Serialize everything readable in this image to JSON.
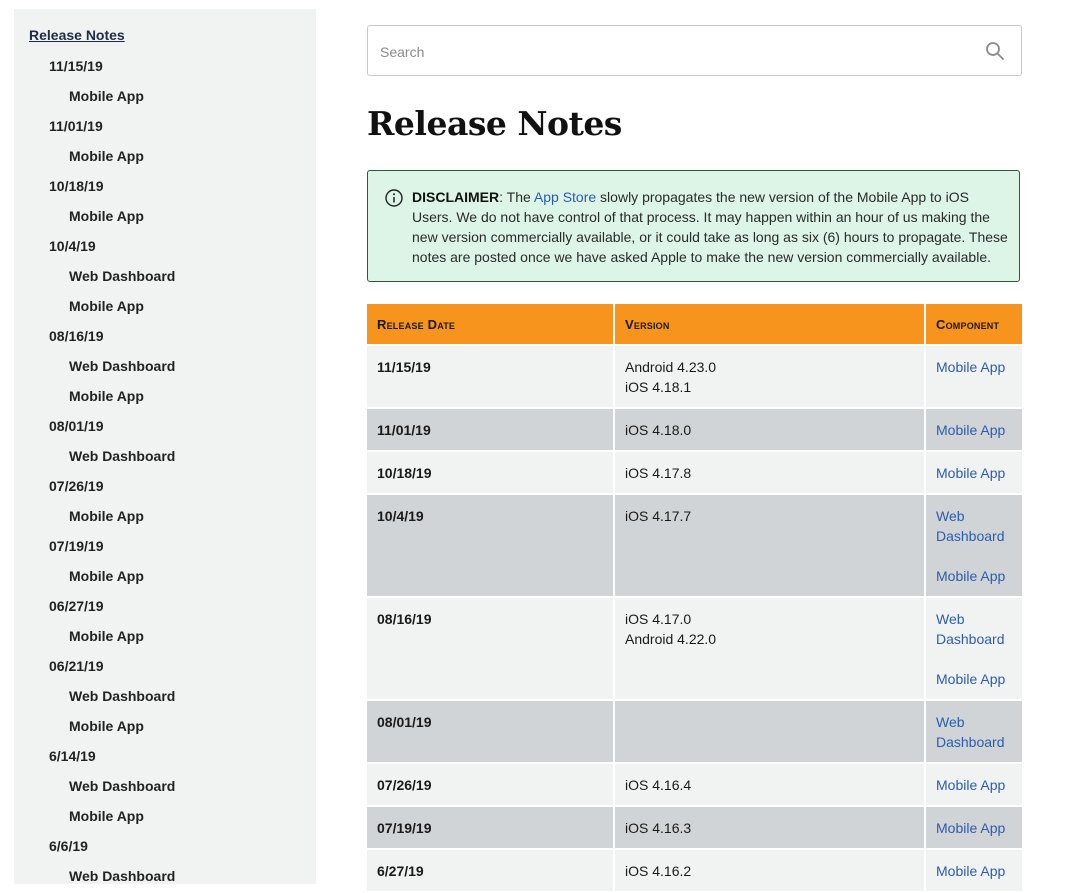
{
  "sidebar": {
    "root": "Release Notes",
    "items": [
      {
        "date": "11/15/19",
        "components": [
          "Mobile App"
        ]
      },
      {
        "date": "11/01/19",
        "components": [
          "Mobile App"
        ]
      },
      {
        "date": "10/18/19",
        "components": [
          "Mobile App"
        ]
      },
      {
        "date": "10/4/19",
        "components": [
          "Web Dashboard",
          "Mobile App"
        ]
      },
      {
        "date": "08/16/19",
        "components": [
          "Web Dashboard",
          "Mobile App"
        ]
      },
      {
        "date": "08/01/19",
        "components": [
          "Web Dashboard"
        ]
      },
      {
        "date": "07/26/19",
        "components": [
          "Mobile App"
        ]
      },
      {
        "date": "07/19/19",
        "components": [
          "Mobile App"
        ]
      },
      {
        "date": "06/27/19",
        "components": [
          "Mobile App"
        ]
      },
      {
        "date": "06/21/19",
        "components": [
          "Web Dashboard",
          "Mobile App"
        ]
      },
      {
        "date": "6/14/19",
        "components": [
          "Web Dashboard",
          "Mobile App"
        ]
      },
      {
        "date": "6/6/19",
        "components": [
          "Web Dashboard"
        ]
      }
    ]
  },
  "search": {
    "placeholder": "Search",
    "icon": "search-icon"
  },
  "page": {
    "title": "Release Notes"
  },
  "disclaimer": {
    "icon": "info-icon",
    "label": "DISCLAIMER",
    "text_before_link": ": The ",
    "link_text": "App Store",
    "text_after_link": " slowly propagates the new version of the Mobile App to iOS Users. We do not have control of that process. It may happen within an hour of us making the new version commercially available, or it could take as long as six (6) hours to propagate. These notes are posted once we have asked Apple to make the new version commercially available."
  },
  "table": {
    "headers": [
      "Release Date",
      "Version",
      "Component"
    ],
    "rows": [
      {
        "date": "11/15/19",
        "versions": [
          "Android 4.23.0",
          "iOS 4.18.1"
        ],
        "components": [
          "Mobile App"
        ]
      },
      {
        "date": "11/01/19",
        "versions": [
          "iOS 4.18.0"
        ],
        "components": [
          "Mobile App"
        ]
      },
      {
        "date": "10/18/19",
        "versions": [
          "iOS 4.17.8"
        ],
        "components": [
          "Mobile App"
        ]
      },
      {
        "date": "10/4/19",
        "versions": [
          "iOS 4.17.7"
        ],
        "components": [
          "Web Dashboard",
          "Mobile App"
        ]
      },
      {
        "date": "08/16/19",
        "versions": [
          "iOS 4.17.0",
          "Android 4.22.0"
        ],
        "components": [
          "Web Dashboard",
          "Mobile App"
        ]
      },
      {
        "date": "08/01/19",
        "versions": [],
        "components": [
          "Web Dashboard"
        ]
      },
      {
        "date": "07/26/19",
        "versions": [
          "iOS 4.16.4"
        ],
        "components": [
          "Mobile App"
        ]
      },
      {
        "date": "07/19/19",
        "versions": [
          "iOS 4.16.3"
        ],
        "components": [
          "Mobile App"
        ]
      },
      {
        "date": "6/27/19",
        "versions": [
          "iOS 4.16.2"
        ],
        "components": [
          "Mobile App"
        ]
      }
    ]
  },
  "colors": {
    "sidebar_bg": "#f1f3f2",
    "header_orange": "#f7941d",
    "row_light": "#f1f3f2",
    "row_dark": "#d1d4d6",
    "link_blue": "#2a5db0",
    "disclaimer_bg": "#dcf5e6"
  }
}
